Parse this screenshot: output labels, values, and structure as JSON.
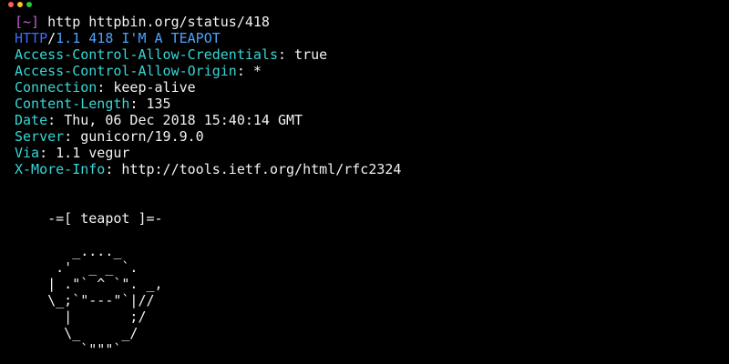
{
  "window": {
    "lights": [
      {
        "name": "close",
        "color": "#ff5f57"
      },
      {
        "name": "minimize",
        "color": "#febc2e"
      },
      {
        "name": "zoom",
        "color": "#28c840"
      }
    ]
  },
  "colors": {
    "background": "#000000",
    "prompt": "#c15fd6",
    "protocol": "#3b6cff",
    "status": "#4aa3ff",
    "header_key": "#37d6d6",
    "text": "#f2f2f2"
  },
  "command": {
    "prompt": "[~]",
    "text": "http httpbin.org/status/418"
  },
  "status_line": {
    "protocol": "HTTP",
    "separator": "/",
    "version_status": "1.1 418 I'M A TEAPOT"
  },
  "headers": [
    {
      "key": "Access-Control-Allow-Credentials",
      "value": "true"
    },
    {
      "key": "Access-Control-Allow-Origin",
      "value": "*"
    },
    {
      "key": "Connection",
      "value": "keep-alive"
    },
    {
      "key": "Content-Length",
      "value": "135"
    },
    {
      "key": "Date",
      "value": "Thu, 06 Dec 2018 15:40:14 GMT"
    },
    {
      "key": "Server",
      "value": "gunicorn/19.9.0"
    },
    {
      "key": "Via",
      "value": "1.1 vegur"
    },
    {
      "key": "X-More-Info",
      "value": "http://tools.ietf.org/html/rfc2324"
    }
  ],
  "body": {
    "title": "    -=[ teapot ]=-",
    "art": [
      "       _...._",
      "     .'  _ _ `.",
      "    | .\"` ^ `\". _,",
      "    \\_;`\"---\"`|//",
      "      |       ;/",
      "      \\_     _/",
      "        `\"\"\"`"
    ]
  }
}
